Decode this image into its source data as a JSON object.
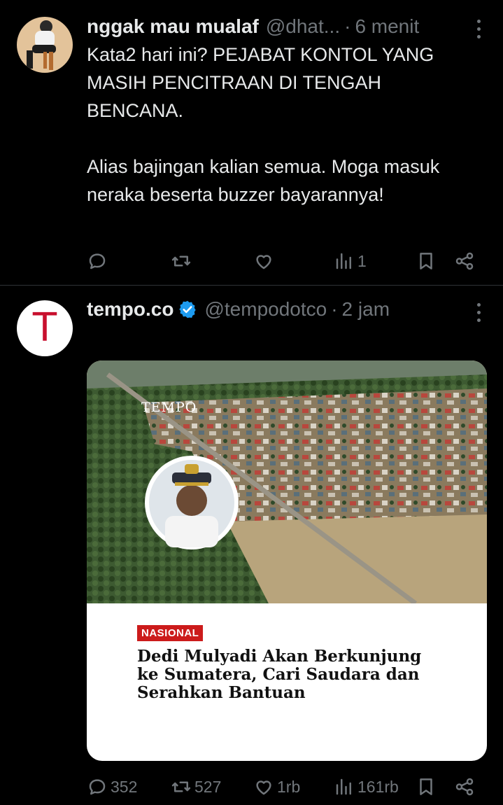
{
  "tweets": [
    {
      "name": "nggak mau mualaf",
      "handle": "@dhat...",
      "time": "6 menit",
      "text": "Kata2 hari ini? PEJABAT KONTOL YANG MASIH PENCITRAAN DI TENGAH BENCANA.\n\nAlias bajingan kalian semua. Moga masuk neraka beserta buzzer bayarannya!",
      "actions": {
        "reply": "",
        "repost": "",
        "like": "",
        "views": "1"
      }
    },
    {
      "name": "tempo.co",
      "handle": "@tempodotco",
      "time": "2 jam",
      "avatar_letter": "T",
      "verified_color": "#1d9bf0",
      "card": {
        "watermark": "TEMPO",
        "category": "NASIONAL",
        "headline": "Dedi Mulyadi Akan Berkunjung ke Sumatera, Cari Saudara dan Serahkan Bantuan"
      },
      "actions": {
        "reply": "352",
        "repost": "527",
        "like": "1rb",
        "views": "161rb"
      }
    }
  ],
  "colors": {
    "background": "#000000",
    "text": "#e7e9ea",
    "muted": "#71767b",
    "divider": "#2f3336",
    "badge": "#cc1b1b"
  },
  "icons": [
    "reply-icon",
    "repost-icon",
    "like-icon",
    "views-icon",
    "bookmark-icon",
    "share-icon",
    "more-icon",
    "verified-icon"
  ]
}
